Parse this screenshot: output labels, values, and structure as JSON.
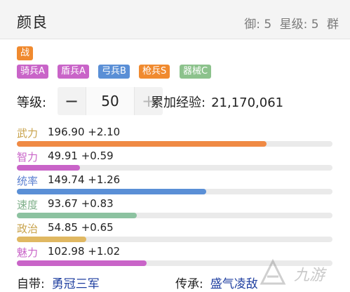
{
  "header": {
    "title": "颜良",
    "defense": "御: 5",
    "star": "星级: 5",
    "group": "群"
  },
  "tags": {
    "type": {
      "label": "战",
      "color": "#f08a2f"
    },
    "troops": [
      {
        "label": "骑兵A",
        "color": "#c964c8"
      },
      {
        "label": "盾兵A",
        "color": "#c964c8"
      },
      {
        "label": "弓兵B",
        "color": "#5a8fd6"
      },
      {
        "label": "枪兵S",
        "color": "#f08a2f"
      },
      {
        "label": "器械C",
        "color": "#8cc28c"
      }
    ]
  },
  "level": {
    "label": "等级:",
    "minus": "−",
    "value": "50",
    "plus": "+",
    "exp_label": "累加经验:",
    "exp_value": "21,170,061"
  },
  "stats": [
    {
      "name": "武力",
      "value": "196.90 +2.10",
      "name_color": "#c8a24a",
      "bar_color": "#f08a44",
      "fraction": 0.79
    },
    {
      "name": "智力",
      "value": "49.91 +0.59",
      "name_color": "#c964c8",
      "bar_color": "#c964c8",
      "fraction": 0.2
    },
    {
      "name": "统率",
      "value": "149.74 +1.26",
      "name_color": "#5a7fd0",
      "bar_color": "#5a8fd6",
      "fraction": 0.6
    },
    {
      "name": "速度",
      "value": "93.67 +0.83",
      "name_color": "#7fb08a",
      "bar_color": "#8cc2a0",
      "fraction": 0.38
    },
    {
      "name": "政治",
      "value": "54.85 +0.65",
      "name_color": "#c8a24a",
      "bar_color": "#e0b862",
      "fraction": 0.22
    },
    {
      "name": "魅力",
      "value": "102.98 +1.02",
      "name_color": "#c964c8",
      "bar_color": "#c964c8",
      "fraction": 0.41
    }
  ],
  "footer": {
    "carry_label": "自带:",
    "carry_skill": "勇冠三军",
    "inherit_label": "传承:",
    "inherit_skill": "盛气凌敌"
  },
  "watermark": {
    "text": "九游",
    "icon": "jiuyou-logo-icon"
  }
}
